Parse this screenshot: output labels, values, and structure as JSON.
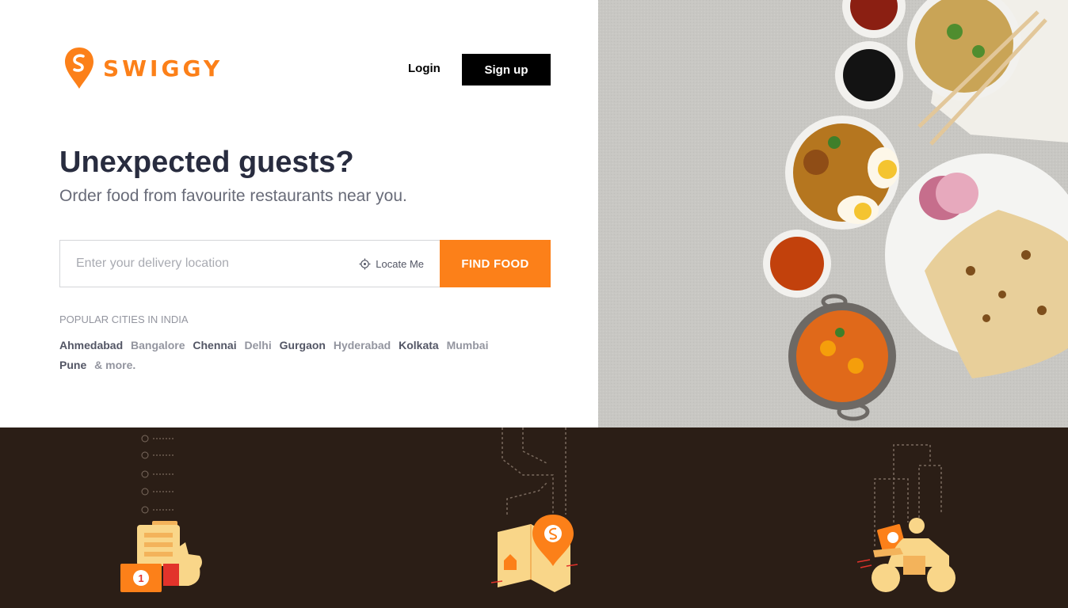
{
  "brand": {
    "name": "SWIGGY",
    "color": "#fc8019"
  },
  "header": {
    "login_label": "Login",
    "signup_label": "Sign up"
  },
  "hero": {
    "title": "Unexpected guests?",
    "subtitle": "Order food from favourite restaurants near you."
  },
  "search": {
    "placeholder": "Enter your delivery location",
    "value": "",
    "locate_label": "Locate Me",
    "locate_icon": "crosshair-icon",
    "find_label": "FIND FOOD"
  },
  "popular": {
    "title": "POPULAR CITIES IN INDIA",
    "cities": [
      {
        "name": "Ahmedabad",
        "tone": "dark"
      },
      {
        "name": "Bangalore",
        "tone": "light"
      },
      {
        "name": "Chennai",
        "tone": "dark"
      },
      {
        "name": "Delhi",
        "tone": "light"
      },
      {
        "name": "Gurgaon",
        "tone": "dark"
      },
      {
        "name": "Hyderabad",
        "tone": "light"
      },
      {
        "name": "Kolkata",
        "tone": "dark"
      },
      {
        "name": "Mumbai",
        "tone": "light"
      },
      {
        "name": "Pune",
        "tone": "dark"
      },
      {
        "name": "& more.",
        "tone": "light"
      }
    ]
  },
  "colors": {
    "accent": "#fc8019",
    "dark_band": "#2b1e16",
    "heading": "#282c3f",
    "muted": "#686b78",
    "illustration_cream": "#f9d689"
  },
  "features": [
    {
      "icon": "order-menu-thumbs-up-icon",
      "badge": "1"
    },
    {
      "icon": "map-location-pin-icon"
    },
    {
      "icon": "delivery-scooter-icon"
    }
  ]
}
